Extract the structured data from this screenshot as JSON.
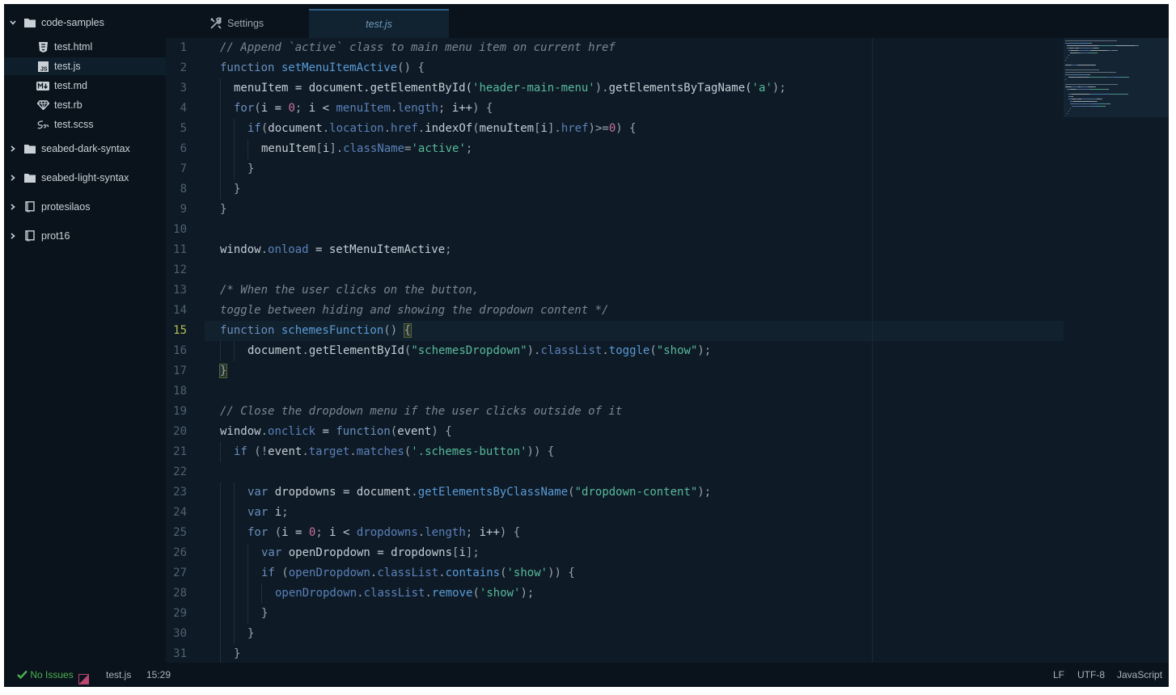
{
  "sidebar": {
    "root": "code-samples",
    "files": [
      "test.html",
      "test.js",
      "test.md",
      "test.rb",
      "test.scss"
    ],
    "folders": [
      "seabed-dark-syntax",
      "seabed-light-syntax"
    ],
    "repos": [
      "protesilaos",
      "prot16"
    ],
    "selected": "test.js"
  },
  "tabs": [
    {
      "label": "Settings",
      "icon": "tools-icon"
    },
    {
      "label": "test.js",
      "active": true
    }
  ],
  "editor": {
    "current_line": 15,
    "line_numbers": [
      "1",
      "2",
      "3",
      "4",
      "5",
      "6",
      "7",
      "8",
      "9",
      "10",
      "11",
      "12",
      "13",
      "14",
      "15",
      "16",
      "17",
      "18",
      "19",
      "20",
      "21",
      "22",
      "23",
      "24",
      "25",
      "26",
      "27",
      "28",
      "29",
      "30",
      "31"
    ],
    "lines": [
      {
        "i": 0,
        "t": [
          [
            "cm",
            "// Append `active` class to main menu item on current href"
          ]
        ]
      },
      {
        "i": 0,
        "t": [
          [
            "kw",
            "function "
          ],
          [
            "fn",
            "setMenuItemActive"
          ],
          [
            "pu",
            "() {"
          ]
        ]
      },
      {
        "i": 1,
        "t": [
          [
            "tx",
            "menuItem = document.getElementById("
          ],
          [
            "st",
            "'header-main-menu'"
          ],
          [
            "pu",
            ")."
          ],
          [
            "tx",
            "getElementsByTagName("
          ],
          [
            "st",
            "'a'"
          ],
          [
            "pu",
            ");"
          ]
        ]
      },
      {
        "i": 1,
        "t": [
          [
            "kw",
            "for"
          ],
          [
            "pu",
            "("
          ],
          [
            "tx",
            "i = "
          ],
          [
            "nu",
            "0"
          ],
          [
            "pu",
            "; "
          ],
          [
            "tx",
            "i < "
          ],
          [
            "pr",
            "menuItem"
          ],
          [
            "pu",
            "."
          ],
          [
            "pr",
            "length"
          ],
          [
            "pu",
            "; "
          ],
          [
            "tx",
            "i++"
          ],
          [
            "pu",
            ") {"
          ]
        ]
      },
      {
        "i": 2,
        "t": [
          [
            "kw",
            "if"
          ],
          [
            "pu",
            "("
          ],
          [
            "tx",
            "document"
          ],
          [
            "pu",
            "."
          ],
          [
            "pr",
            "location"
          ],
          [
            "pu",
            "."
          ],
          [
            "pr",
            "href"
          ],
          [
            "pu",
            "."
          ],
          [
            "tx",
            "indexOf"
          ],
          [
            "pu",
            "("
          ],
          [
            "tx",
            "menuItem"
          ],
          [
            "pu",
            "["
          ],
          [
            "tx",
            "i"
          ],
          [
            "pu",
            "]."
          ],
          [
            "pr",
            "href"
          ],
          [
            "pu",
            ")>="
          ],
          [
            "nu",
            "0"
          ],
          [
            "pu",
            ") {"
          ]
        ]
      },
      {
        "i": 3,
        "t": [
          [
            "tx",
            "menuItem"
          ],
          [
            "pu",
            "["
          ],
          [
            "tx",
            "i"
          ],
          [
            "pu",
            "]."
          ],
          [
            "pr",
            "className"
          ],
          [
            "pu",
            "="
          ],
          [
            "st",
            "'active'"
          ],
          [
            "pu",
            ";"
          ]
        ]
      },
      {
        "i": 2,
        "t": [
          [
            "pu",
            "}"
          ]
        ]
      },
      {
        "i": 1,
        "t": [
          [
            "pu",
            "}"
          ]
        ]
      },
      {
        "i": 0,
        "t": [
          [
            "pu",
            "}"
          ]
        ]
      },
      {
        "i": 0,
        "t": []
      },
      {
        "i": 0,
        "t": [
          [
            "tx",
            "window"
          ],
          [
            "pu",
            "."
          ],
          [
            "pr",
            "onload"
          ],
          [
            "tx",
            " = setMenuItemActive"
          ],
          [
            "pu",
            ";"
          ]
        ]
      },
      {
        "i": 0,
        "t": []
      },
      {
        "i": 0,
        "t": [
          [
            "cm",
            "/* When the user clicks on the button,"
          ]
        ]
      },
      {
        "i": 0,
        "t": [
          [
            "cm",
            "toggle between hiding and showing the dropdown content */"
          ]
        ]
      },
      {
        "i": 0,
        "t": [
          [
            "kw",
            "function "
          ],
          [
            "fn",
            "schemesFunction"
          ],
          [
            "pu",
            "() "
          ],
          [
            "br",
            "{"
          ]
        ]
      },
      {
        "i": 2,
        "t": [
          [
            "tx",
            "document"
          ],
          [
            "pu",
            "."
          ],
          [
            "tx",
            "getElementById"
          ],
          [
            "pu",
            "("
          ],
          [
            "st",
            "\"schemesDropdown\""
          ],
          [
            "pu",
            ")."
          ],
          [
            "pr",
            "classList"
          ],
          [
            "pu",
            "."
          ],
          [
            "fn",
            "toggle"
          ],
          [
            "pu",
            "("
          ],
          [
            "st",
            "\"show\""
          ],
          [
            "pu",
            ");"
          ]
        ]
      },
      {
        "i": 0,
        "t": [
          [
            "br",
            "}"
          ]
        ]
      },
      {
        "i": 0,
        "t": []
      },
      {
        "i": 0,
        "t": [
          [
            "cm",
            "// Close the dropdown menu if the user clicks outside of it"
          ]
        ]
      },
      {
        "i": 0,
        "t": [
          [
            "tx",
            "window"
          ],
          [
            "pu",
            "."
          ],
          [
            "pr",
            "onclick"
          ],
          [
            "tx",
            " = "
          ],
          [
            "kw",
            "function"
          ],
          [
            "pu",
            "("
          ],
          [
            "tx",
            "event"
          ],
          [
            "pu",
            ") {"
          ]
        ]
      },
      {
        "i": 1,
        "t": [
          [
            "kw",
            "if "
          ],
          [
            "pu",
            "(!"
          ],
          [
            "tx",
            "event"
          ],
          [
            "pu",
            "."
          ],
          [
            "pr",
            "target"
          ],
          [
            "pu",
            "."
          ],
          [
            "pr",
            "matches"
          ],
          [
            "pu",
            "("
          ],
          [
            "st",
            "'.schemes-button'"
          ],
          [
            "pu",
            ")) {"
          ]
        ]
      },
      {
        "i": 0,
        "t": []
      },
      {
        "i": 2,
        "t": [
          [
            "kw",
            "var "
          ],
          [
            "tx",
            "dropdowns = document"
          ],
          [
            "pu",
            "."
          ],
          [
            "fn",
            "getElementsByClassName"
          ],
          [
            "pu",
            "("
          ],
          [
            "st",
            "\"dropdown-content\""
          ],
          [
            "pu",
            ");"
          ]
        ]
      },
      {
        "i": 2,
        "t": [
          [
            "kw",
            "var "
          ],
          [
            "tx",
            "i"
          ],
          [
            "pu",
            ";"
          ]
        ]
      },
      {
        "i": 2,
        "t": [
          [
            "kw",
            "for "
          ],
          [
            "pu",
            "("
          ],
          [
            "tx",
            "i = "
          ],
          [
            "nu",
            "0"
          ],
          [
            "pu",
            "; "
          ],
          [
            "tx",
            "i < "
          ],
          [
            "pr",
            "dropdowns"
          ],
          [
            "pu",
            "."
          ],
          [
            "pr",
            "length"
          ],
          [
            "pu",
            "; "
          ],
          [
            "tx",
            "i++"
          ],
          [
            "pu",
            ") {"
          ]
        ]
      },
      {
        "i": 3,
        "t": [
          [
            "kw",
            "var "
          ],
          [
            "tx",
            "openDropdown = dropdowns"
          ],
          [
            "pu",
            "["
          ],
          [
            "tx",
            "i"
          ],
          [
            "pu",
            "];"
          ]
        ]
      },
      {
        "i": 3,
        "t": [
          [
            "kw",
            "if "
          ],
          [
            "pu",
            "("
          ],
          [
            "pr",
            "openDropdown"
          ],
          [
            "pu",
            "."
          ],
          [
            "pr",
            "classList"
          ],
          [
            "pu",
            "."
          ],
          [
            "fn",
            "contains"
          ],
          [
            "pu",
            "("
          ],
          [
            "st",
            "'show'"
          ],
          [
            "pu",
            ")) {"
          ]
        ]
      },
      {
        "i": 4,
        "t": [
          [
            "pr",
            "openDropdown"
          ],
          [
            "pu",
            "."
          ],
          [
            "pr",
            "classList"
          ],
          [
            "pu",
            "."
          ],
          [
            "fn",
            "remove"
          ],
          [
            "pu",
            "("
          ],
          [
            "st",
            "'show'"
          ],
          [
            "pu",
            ");"
          ]
        ]
      },
      {
        "i": 3,
        "t": [
          [
            "pu",
            "}"
          ]
        ]
      },
      {
        "i": 2,
        "t": [
          [
            "pu",
            "}"
          ]
        ]
      },
      {
        "i": 1,
        "t": [
          [
            "pu",
            "}"
          ]
        ]
      }
    ]
  },
  "status": {
    "issues": "No Issues",
    "file": "test.js",
    "cursor": "15:29",
    "line_ending": "LF",
    "encoding": "UTF-8",
    "grammar": "JavaScript"
  },
  "colors": {
    "background": "#0e1a26",
    "sidebar": "#0a131b",
    "keyword": "#6a8fbd",
    "function": "#5a9bd6",
    "string": "#58b99a",
    "number": "#c8739c",
    "comment": "#7b8793",
    "success": "#4cb050"
  }
}
